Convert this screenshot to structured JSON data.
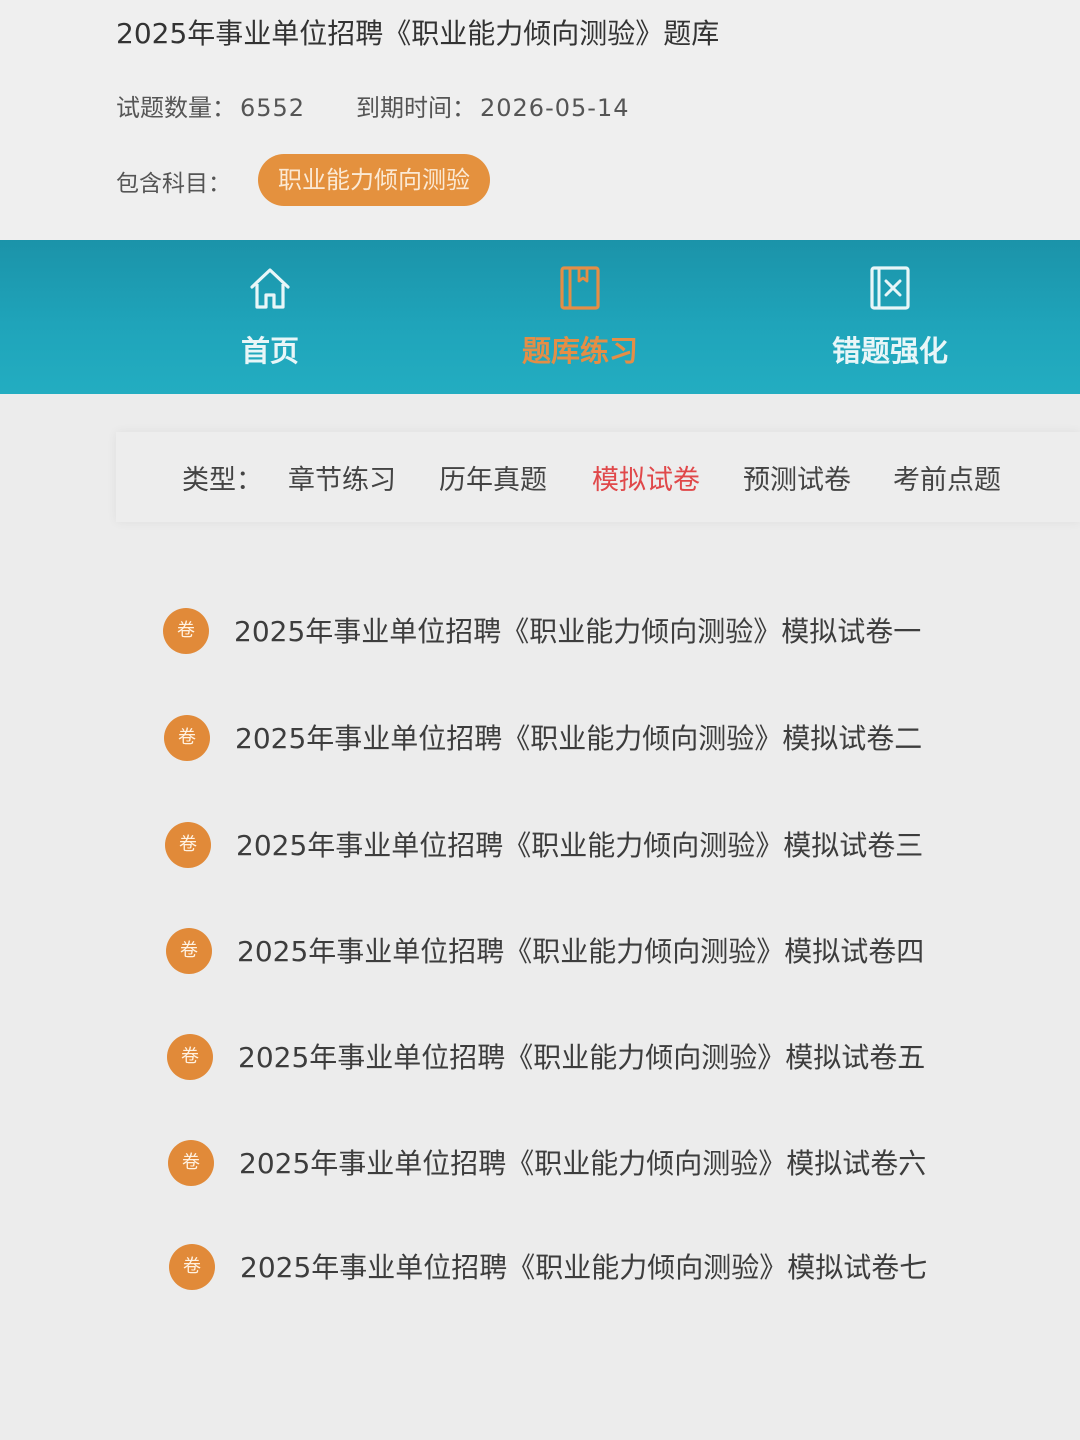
{
  "header": {
    "title": "2025年事业单位招聘《职业能力倾向测验》题库",
    "count_label": "试题数量：",
    "count_value": "6552",
    "expire_label": "到期时间：",
    "expire_value": "2026-05-14",
    "subject_label": "包含科目：",
    "subject_tag": "职业能力倾向测验"
  },
  "nav": {
    "items": [
      {
        "label": "首页",
        "icon": "home-icon"
      },
      {
        "label": "题库练习",
        "icon": "book-icon"
      },
      {
        "label": "错题强化",
        "icon": "wrong-book-icon"
      }
    ],
    "active_index": 1
  },
  "filter": {
    "label": "类型：",
    "options": [
      "章节练习",
      "历年真题",
      "模拟试卷",
      "预测试卷",
      "考前点题"
    ],
    "active_index": 2
  },
  "papers": {
    "badge": "卷",
    "items": [
      "2025年事业单位招聘《职业能力倾向测验》模拟试卷一",
      "2025年事业单位招聘《职业能力倾向测验》模拟试卷二",
      "2025年事业单位招聘《职业能力倾向测验》模拟试卷三",
      "2025年事业单位招聘《职业能力倾向测验》模拟试卷四",
      "2025年事业单位招聘《职业能力倾向测验》模拟试卷五",
      "2025年事业单位招聘《职业能力倾向测验》模拟试卷六",
      "2025年事业单位招聘《职业能力倾向测验》模拟试卷七"
    ]
  },
  "colors": {
    "accent_orange": "#e4913e",
    "nav_teal": "#1fa4ba",
    "active_filter_red": "#e0484a"
  }
}
